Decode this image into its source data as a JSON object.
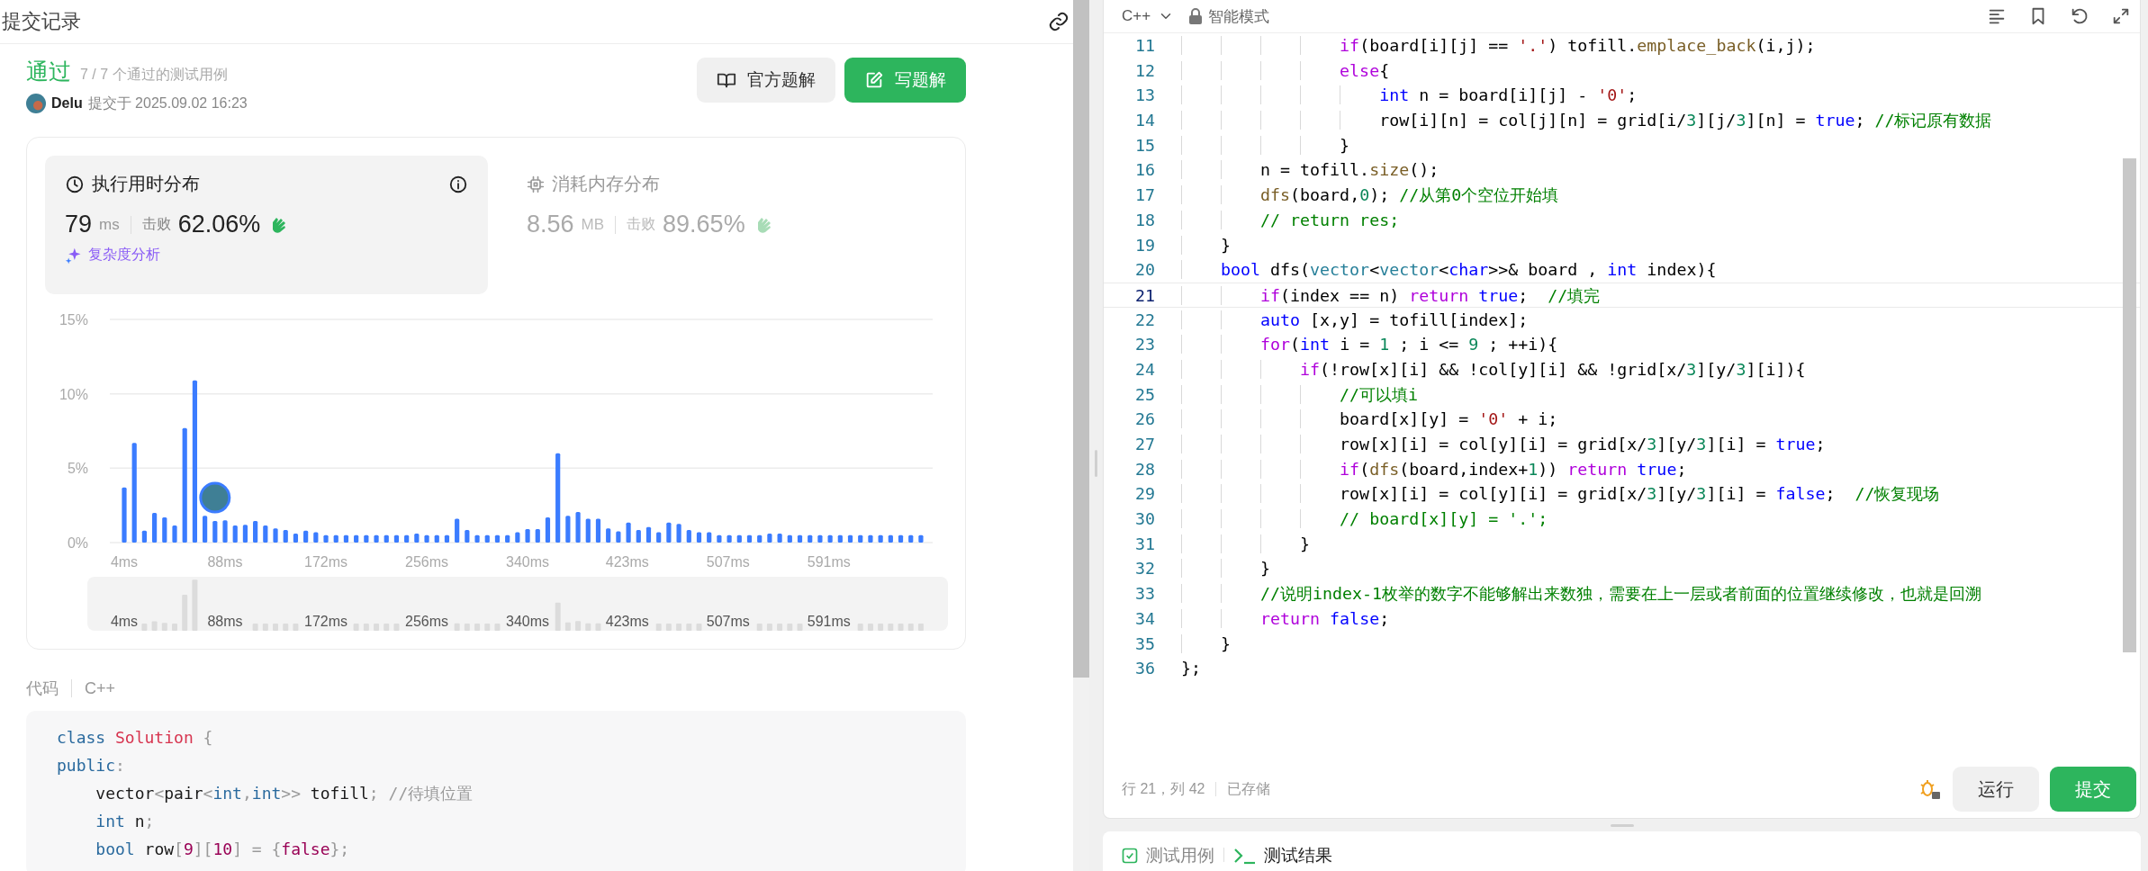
{
  "submission_panel": {
    "title": "提交记录"
  },
  "result": {
    "status": "通过",
    "testcases": "7 / 7 个通过的测试用例",
    "user": "Delu",
    "submitted": "提交于 2025.09.02 16:23"
  },
  "buttons": [
    {
      "label": "官方题解",
      "kind": "secondary"
    },
    {
      "label": "写题解",
      "kind": "primary"
    }
  ],
  "stats": [
    {
      "title": "执行用时分布",
      "value": "79",
      "unit": "ms",
      "beats_label": "击败",
      "beats": "62.06%",
      "link": "复杂度分析",
      "selected": true,
      "kind": "time"
    },
    {
      "title": "消耗内存分布",
      "value": "8.56",
      "unit": "MB",
      "beats_label": "击败",
      "beats": "89.65%",
      "selected": false,
      "kind": "memory"
    }
  ],
  "chart_data": {
    "type": "bar",
    "x": [
      4,
      12.4,
      20.8,
      29.2,
      37.6,
      46,
      54.4,
      62.8,
      71.2,
      79.6,
      88,
      96.4,
      104.8,
      113.2,
      121.6,
      130,
      138.4,
      146.8,
      155.2,
      163.6,
      172,
      180.4,
      188.8,
      197.2,
      205.6,
      214,
      222.4,
      230.8,
      239.2,
      247.6,
      256,
      264.4,
      272.8,
      281.2,
      289.6,
      298,
      306.4,
      314.8,
      323.2,
      331.6,
      340,
      348.4,
      356.8,
      365.2,
      373.6,
      382,
      390.4,
      398.8,
      407.2,
      415.6,
      424,
      432.4,
      440.8,
      449.2,
      457.6,
      466,
      474.4,
      482.8,
      491.2,
      499.6,
      508,
      516.4,
      524.8,
      533.2,
      541.6,
      550,
      558.4,
      566.8,
      575.2,
      583.6,
      592,
      600.4,
      608.8,
      617.2,
      625.6,
      634,
      642.4,
      650.8,
      659.2,
      667.6
    ],
    "values": [
      3.7,
      6.7,
      0.8,
      2.0,
      1.7,
      1.15,
      7.7,
      10.9,
      1.8,
      1.45,
      1.5,
      1.15,
      1.2,
      1.45,
      1.15,
      0.95,
      0.85,
      0.6,
      0.8,
      0.7,
      0.5,
      0.5,
      0.5,
      0.5,
      0.5,
      0.5,
      0.5,
      0.5,
      0.5,
      0.6,
      0.5,
      0.5,
      0.5,
      1.6,
      0.85,
      0.5,
      0.5,
      0.5,
      0.5,
      0.7,
      0.9,
      0.9,
      1.7,
      6.0,
      1.8,
      2.05,
      1.6,
      1.6,
      0.95,
      0.75,
      1.35,
      0.85,
      1.05,
      0.7,
      1.35,
      1.25,
      0.85,
      0.7,
      0.7,
      0.5,
      0.5,
      0.5,
      0.5,
      0.5,
      0.6,
      0.6,
      0.5,
      0.5,
      0.5,
      0.5,
      0.5,
      0.5,
      0.5,
      0.5,
      0.5,
      0.5,
      0.5,
      0.5,
      0.5,
      0.5
    ],
    "xlim": [
      -8,
      677.4
    ],
    "ylim": [
      0,
      15
    ],
    "yticks": [
      {
        "value": 0,
        "label": "0%"
      },
      {
        "value": 5,
        "label": "5%"
      },
      {
        "value": 10,
        "label": "10%"
      },
      {
        "value": 15,
        "label": "15%"
      }
    ],
    "xticks": [
      {
        "value": 4,
        "label": "4ms"
      },
      {
        "value": 88,
        "label": "88ms"
      },
      {
        "value": 172,
        "label": "172ms"
      },
      {
        "value": 256,
        "label": "256ms"
      },
      {
        "value": 340,
        "label": "340ms"
      },
      {
        "value": 423,
        "label": "423ms"
      },
      {
        "value": 507,
        "label": "507ms"
      },
      {
        "value": 591,
        "label": "591ms"
      }
    ]
  },
  "overview": {
    "labels": [
      "4ms",
      "88ms",
      "172ms",
      "256ms",
      "340ms",
      "423ms",
      "507ms",
      "591ms"
    ]
  },
  "code_section": {
    "label": "代码",
    "language": "C++",
    "lines": [
      [
        {
          "text": "class",
          "kind": "keyword"
        },
        {
          "text": " Solution",
          "kind": "class-name"
        },
        {
          "text": " {",
          "kind": "punct"
        }
      ],
      [
        {
          "text": "public",
          "kind": "keyword"
        },
        {
          "text": ":",
          "kind": "punct"
        }
      ],
      [
        {
          "text": "    vector",
          "kind": "plain"
        },
        {
          "text": "<",
          "kind": "punct"
        },
        {
          "text": "pair",
          "kind": "plain"
        },
        {
          "text": "<",
          "kind": "punct"
        },
        {
          "text": "int",
          "kind": "keyword"
        },
        {
          "text": ",",
          "kind": "punct"
        },
        {
          "text": "int",
          "kind": "keyword"
        },
        {
          "text": ">>",
          "kind": "punct"
        },
        {
          "text": " tofill",
          "kind": "plain"
        },
        {
          "text": ";",
          "kind": "punct"
        },
        {
          "text": " //待填位置",
          "kind": "comment"
        }
      ],
      [
        {
          "text": "    int",
          "kind": "keyword"
        },
        {
          "text": " n",
          "kind": "plain"
        },
        {
          "text": ";",
          "kind": "punct"
        }
      ],
      [
        {
          "text": "    bool",
          "kind": "keyword"
        },
        {
          "text": " row",
          "kind": "plain"
        },
        {
          "text": "[",
          "kind": "punct"
        },
        {
          "text": "9",
          "kind": "number"
        },
        {
          "text": "][",
          "kind": "punct"
        },
        {
          "text": "10",
          "kind": "number"
        },
        {
          "text": "] = {",
          "kind": "punct"
        },
        {
          "text": "false",
          "kind": "number"
        },
        {
          "text": "};",
          "kind": "punct"
        }
      ]
    ]
  },
  "editor": {
    "language": "C++",
    "mode": "智能模式",
    "lines": [
      {
        "number": "11",
        "current": false,
        "tokens": [
          {
            "text": "                if",
            "kind": "keyword"
          },
          {
            "text": "(board[i][j] == ",
            "kind": "plain"
          },
          {
            "text": "'.'",
            "kind": "string"
          },
          {
            "text": ") tofill.",
            "kind": "plain"
          },
          {
            "text": "emplace_back",
            "kind": "function"
          },
          {
            "text": "(i,j);",
            "kind": "plain"
          }
        ]
      },
      {
        "number": "12",
        "current": false,
        "tokens": [
          {
            "text": "                else",
            "kind": "keyword"
          },
          {
            "text": "{",
            "kind": "plain"
          }
        ]
      },
      {
        "number": "13",
        "current": false,
        "tokens": [
          {
            "text": "                    int",
            "kind": "type"
          },
          {
            "text": " n = board[i][j] - ",
            "kind": "plain"
          },
          {
            "text": "'0'",
            "kind": "string"
          },
          {
            "text": ";",
            "kind": "plain"
          }
        ]
      },
      {
        "number": "14",
        "current": false,
        "tokens": [
          {
            "text": "                    row[i][n] = col[j][n] = grid[i/",
            "kind": "plain"
          },
          {
            "text": "3",
            "kind": "number"
          },
          {
            "text": "][j/",
            "kind": "plain"
          },
          {
            "text": "3",
            "kind": "number"
          },
          {
            "text": "][n] = ",
            "kind": "plain"
          },
          {
            "text": "true",
            "kind": "type"
          },
          {
            "text": "; ",
            "kind": "plain"
          },
          {
            "text": "//标记原有数据",
            "kind": "comment"
          }
        ]
      },
      {
        "number": "15",
        "current": false,
        "tokens": [
          {
            "text": "                }",
            "kind": "plain"
          }
        ]
      },
      {
        "number": "16",
        "current": false,
        "tokens": [
          {
            "text": "        n = tofill.",
            "kind": "plain"
          },
          {
            "text": "size",
            "kind": "function"
          },
          {
            "text": "();",
            "kind": "plain"
          }
        ]
      },
      {
        "number": "17",
        "current": false,
        "tokens": [
          {
            "text": "        dfs",
            "kind": "function"
          },
          {
            "text": "(board,",
            "kind": "plain"
          },
          {
            "text": "0",
            "kind": "number"
          },
          {
            "text": "); ",
            "kind": "plain"
          },
          {
            "text": "//从第0个空位开始填",
            "kind": "comment"
          }
        ]
      },
      {
        "number": "18",
        "current": false,
        "tokens": [
          {
            "text": "        // return res;",
            "kind": "comment"
          }
        ]
      },
      {
        "number": "19",
        "current": false,
        "tokens": [
          {
            "text": "    }",
            "kind": "plain"
          }
        ]
      },
      {
        "number": "20",
        "current": false,
        "tokens": [
          {
            "text": "    bool",
            "kind": "type"
          },
          {
            "text": " dfs(",
            "kind": "plain"
          },
          {
            "text": "vector",
            "kind": "class"
          },
          {
            "text": "<",
            "kind": "plain"
          },
          {
            "text": "vector",
            "kind": "class"
          },
          {
            "text": "<",
            "kind": "plain"
          },
          {
            "text": "char",
            "kind": "type"
          },
          {
            "text": ">>& board , ",
            "kind": "plain"
          },
          {
            "text": "int",
            "kind": "type"
          },
          {
            "text": " index){",
            "kind": "plain"
          }
        ]
      },
      {
        "number": "21",
        "current": true,
        "tokens": [
          {
            "text": "        if",
            "kind": "keyword"
          },
          {
            "text": "(index == n) ",
            "kind": "plain"
          },
          {
            "text": "return ",
            "kind": "keyword"
          },
          {
            "text": "true",
            "kind": "type"
          },
          {
            "text": ";  ",
            "kind": "plain"
          },
          {
            "text": "//填完",
            "kind": "comment"
          }
        ]
      },
      {
        "number": "22",
        "current": false,
        "tokens": [
          {
            "text": "        auto",
            "kind": "type"
          },
          {
            "text": " [x,y] = tofill[index];",
            "kind": "plain"
          }
        ]
      },
      {
        "number": "23",
        "current": false,
        "tokens": [
          {
            "text": "        for",
            "kind": "keyword"
          },
          {
            "text": "(",
            "kind": "plain"
          },
          {
            "text": "int",
            "kind": "type"
          },
          {
            "text": " i = ",
            "kind": "plain"
          },
          {
            "text": "1",
            "kind": "number"
          },
          {
            "text": " ; i <= ",
            "kind": "plain"
          },
          {
            "text": "9",
            "kind": "number"
          },
          {
            "text": " ; ++i){",
            "kind": "plain"
          }
        ]
      },
      {
        "number": "24",
        "current": false,
        "tokens": [
          {
            "text": "            if",
            "kind": "keyword"
          },
          {
            "text": "(!row[x][i] && !col[y][i] && !grid[x/",
            "kind": "plain"
          },
          {
            "text": "3",
            "kind": "number"
          },
          {
            "text": "][y/",
            "kind": "plain"
          },
          {
            "text": "3",
            "kind": "number"
          },
          {
            "text": "][i]){",
            "kind": "plain"
          }
        ]
      },
      {
        "number": "25",
        "current": false,
        "tokens": [
          {
            "text": "                //可以填i",
            "kind": "comment"
          }
        ]
      },
      {
        "number": "26",
        "current": false,
        "tokens": [
          {
            "text": "                board[x][y] = ",
            "kind": "plain"
          },
          {
            "text": "'0'",
            "kind": "string"
          },
          {
            "text": " + i;",
            "kind": "plain"
          }
        ]
      },
      {
        "number": "27",
        "current": false,
        "tokens": [
          {
            "text": "                row[x][i] = col[y][i] = grid[x/",
            "kind": "plain"
          },
          {
            "text": "3",
            "kind": "number"
          },
          {
            "text": "][y/",
            "kind": "plain"
          },
          {
            "text": "3",
            "kind": "number"
          },
          {
            "text": "][i] = ",
            "kind": "plain"
          },
          {
            "text": "true",
            "kind": "type"
          },
          {
            "text": ";",
            "kind": "plain"
          }
        ]
      },
      {
        "number": "28",
        "current": false,
        "tokens": [
          {
            "text": "                if",
            "kind": "keyword"
          },
          {
            "text": "(",
            "kind": "plain"
          },
          {
            "text": "dfs",
            "kind": "function"
          },
          {
            "text": "(board,index+",
            "kind": "plain"
          },
          {
            "text": "1",
            "kind": "number"
          },
          {
            "text": ")) ",
            "kind": "plain"
          },
          {
            "text": "return ",
            "kind": "keyword"
          },
          {
            "text": "true",
            "kind": "type"
          },
          {
            "text": ";",
            "kind": "plain"
          }
        ]
      },
      {
        "number": "29",
        "current": false,
        "tokens": [
          {
            "text": "                row[x][i] = col[y][i] = grid[x/",
            "kind": "plain"
          },
          {
            "text": "3",
            "kind": "number"
          },
          {
            "text": "][y/",
            "kind": "plain"
          },
          {
            "text": "3",
            "kind": "number"
          },
          {
            "text": "][i] = ",
            "kind": "plain"
          },
          {
            "text": "false",
            "kind": "type"
          },
          {
            "text": ";  ",
            "kind": "plain"
          },
          {
            "text": "//恢复现场",
            "kind": "comment"
          }
        ]
      },
      {
        "number": "30",
        "current": false,
        "tokens": [
          {
            "text": "                // board[x][y] = '.';",
            "kind": "comment"
          }
        ]
      },
      {
        "number": "31",
        "current": false,
        "tokens": [
          {
            "text": "            }",
            "kind": "plain"
          }
        ]
      },
      {
        "number": "32",
        "current": false,
        "tokens": [
          {
            "text": "        }",
            "kind": "plain"
          }
        ]
      },
      {
        "number": "33",
        "current": false,
        "tokens": [
          {
            "text": "        //说明index-1枚举的数字不能够解出来数独，需要在上一层或者前面的位置继续修改，也就是回溯",
            "kind": "comment"
          }
        ]
      },
      {
        "number": "34",
        "current": false,
        "tokens": [
          {
            "text": "        return ",
            "kind": "keyword"
          },
          {
            "text": "false",
            "kind": "type"
          },
          {
            "text": ";",
            "kind": "plain"
          }
        ]
      },
      {
        "number": "35",
        "current": false,
        "tokens": [
          {
            "text": "    }",
            "kind": "plain"
          }
        ]
      },
      {
        "number": "36",
        "current": false,
        "tokens": [
          {
            "text": "};",
            "kind": "plain"
          }
        ]
      }
    ],
    "status": {
      "position": "行 21，列 42",
      "saved": "已存储"
    },
    "buttons": [
      {
        "label": "运行",
        "kind": "secondary"
      },
      {
        "label": "提交",
        "kind": "primary"
      }
    ]
  },
  "bottom_tabs": [
    {
      "label": "测试用例",
      "selected": false,
      "kind": "testcase"
    },
    {
      "label": "测试结果",
      "selected": true,
      "kind": "result"
    }
  ]
}
